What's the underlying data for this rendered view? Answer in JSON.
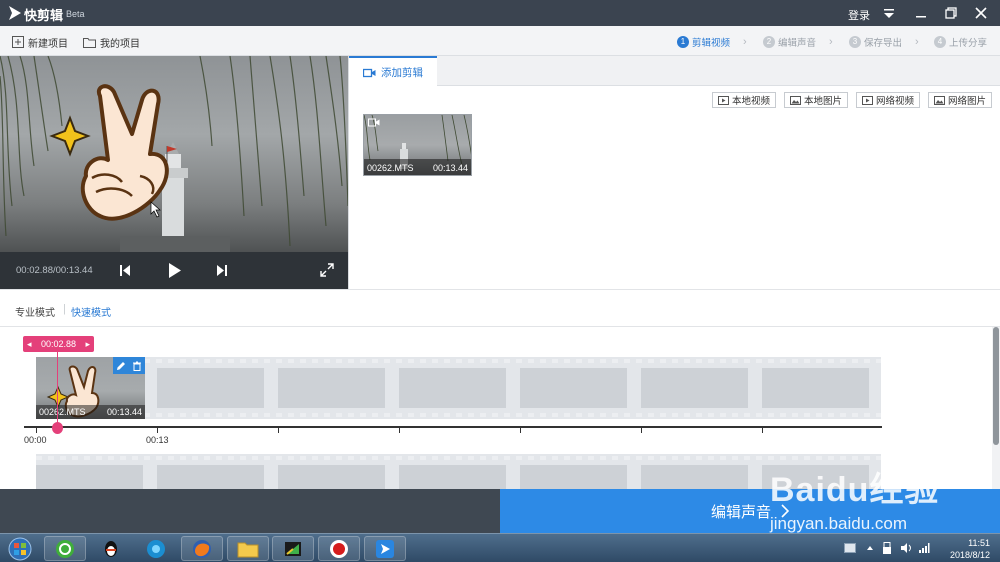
{
  "titlebar": {
    "app_name": "快剪辑",
    "badge": "Beta",
    "login": "登录"
  },
  "toolbar": {
    "new_project": "新建项目",
    "my_projects": "我的项目",
    "steps": [
      {
        "num": "1",
        "label": "剪辑视频"
      },
      {
        "num": "2",
        "label": "编辑声音"
      },
      {
        "num": "3",
        "label": "保存导出"
      },
      {
        "num": "4",
        "label": "上传分享"
      }
    ]
  },
  "preview": {
    "time": "00:02.88/00:13.44"
  },
  "panel": {
    "tab_label": "添加剪辑",
    "sources": [
      "本地视频",
      "本地图片",
      "网络视频",
      "网络图片"
    ],
    "clip": {
      "name": "00262.MTS",
      "duration": "00:13.44"
    }
  },
  "modes": {
    "pro": "专业模式",
    "quick": "快速模式"
  },
  "timeline": {
    "playhead_time": "00:02.88",
    "clip_name": "00262.MTS",
    "clip_duration": "00:13.44",
    "ruler_labels": [
      "00:00",
      "00:13"
    ]
  },
  "bottom": {
    "next_button": "编辑声音"
  },
  "taskbar": {
    "time": "11:51",
    "date": "2018/8/12"
  },
  "watermark": {
    "brand": "Baidu经验",
    "url": "jingyan.baidu.com"
  },
  "colors": {
    "accent": "#2a7ad3",
    "playhead": "#e4407a",
    "titlebar": "#3b4450",
    "action_button": "#2d8ae6"
  }
}
